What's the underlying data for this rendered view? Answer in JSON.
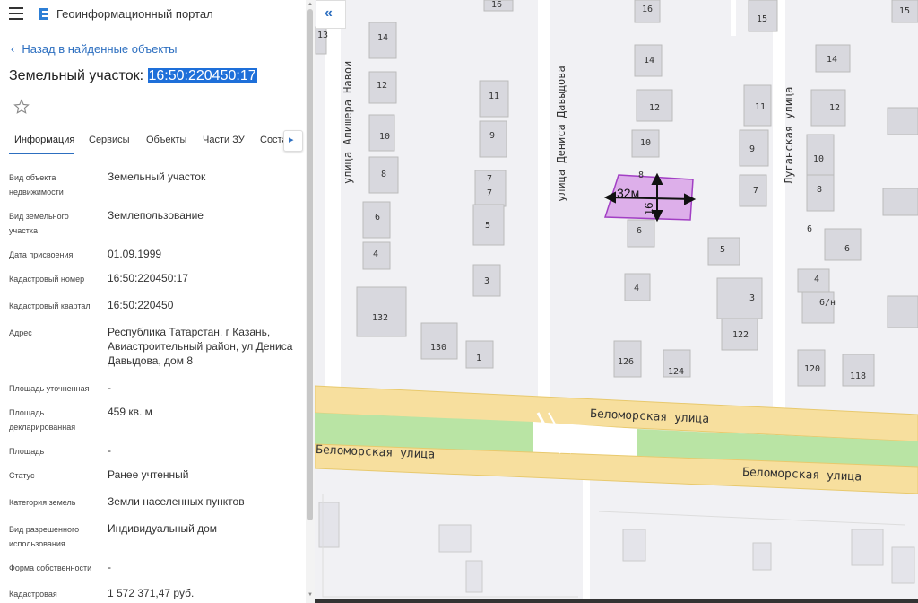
{
  "app": {
    "title": "Геоинформационный портал"
  },
  "nav": {
    "back_label": "Назад в найденные объекты"
  },
  "object": {
    "title_prefix": "Земельный участок:",
    "cadastral_number": "16:50:220450:17"
  },
  "tabs": [
    {
      "label": "Информация"
    },
    {
      "label": "Сервисы"
    },
    {
      "label": "Объекты"
    },
    {
      "label": "Части ЗУ"
    },
    {
      "label": "Соста"
    }
  ],
  "properties": [
    {
      "label": "Вид объекта недвижимости",
      "value": "Земельный участок"
    },
    {
      "label": "Вид земельного участка",
      "value": "Землепользование"
    },
    {
      "label": "Дата присвоения",
      "value": "01.09.1999"
    },
    {
      "label": "Кадастровый номер",
      "value": "16:50:220450:17"
    },
    {
      "label": "Кадастровый квартал",
      "value": "16:50:220450"
    },
    {
      "label": "Адрес",
      "value": "Республика Татарстан, г Казань, Авиастроительный район, ул Дениса Давыдова, дом 8"
    },
    {
      "label": "Площадь уточненная",
      "value": "-"
    },
    {
      "label": "Площадь декларированная",
      "value": "459 кв. м"
    },
    {
      "label": "Площадь",
      "value": "-"
    },
    {
      "label": "Статус",
      "value": "Ранее учтенный"
    },
    {
      "label": "Категория земель",
      "value": "Земли населенных пунктов"
    },
    {
      "label": "Вид разрешенного использования",
      "value": "Индивидуальный дом"
    },
    {
      "label": "Форма собственности",
      "value": "-"
    },
    {
      "label": "Кадастровая",
      "value": "1 572 371,47 руб."
    }
  ],
  "map": {
    "streets": {
      "navoi": "улица Алишера Навои",
      "davydova": "улица Дениса Давыдова",
      "luganskaya": "Луганская улица",
      "belomorskaya_1": "Беломорская улица",
      "belomorskaya_2": "Беломорская улица",
      "belomorskaya_3": "Беломорская улица"
    },
    "measurements": {
      "width": "32м",
      "height": "16"
    },
    "house_numbers": [
      "13",
      "14",
      "12",
      "10",
      "8",
      "6",
      "4",
      "132",
      "130",
      "16",
      "15",
      "11",
      "9",
      "7",
      "7",
      "5",
      "3",
      "1",
      "16",
      "14",
      "12",
      "10",
      "8",
      "6",
      "4",
      "126",
      "124",
      "11",
      "9",
      "7",
      "5",
      "3",
      "122",
      "15",
      "14",
      "12",
      "10",
      "8",
      "6",
      "6",
      "4",
      "6/н",
      "120",
      "118"
    ],
    "colors": {
      "parcel_fill": "#d9a3e8",
      "parcel_stroke": "#a23fc4",
      "road": "#f7df9e",
      "green": "#b9e4a4"
    }
  }
}
